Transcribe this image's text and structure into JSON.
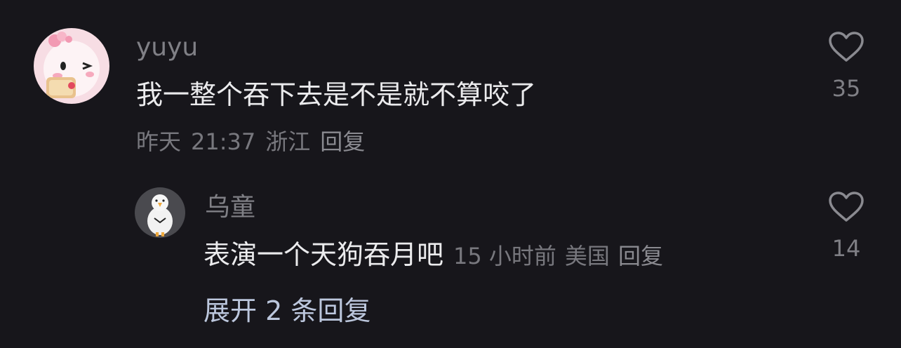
{
  "comment": {
    "username": "yuyu",
    "text": "我一整个吞下去是不是就不算咬了",
    "date": "昨天",
    "time": "21:37",
    "location": "浙江",
    "reply_label": "回复",
    "like_count": "35",
    "avatar_icon": "pink-cartoon-character-avatar"
  },
  "reply": {
    "username": "乌童",
    "text": "表演一个天狗吞月吧",
    "time": "15 小时前",
    "location": "美国",
    "reply_label": "回复",
    "like_count": "14",
    "avatar_icon": "white-duck-avatar"
  },
  "expand_replies": {
    "label": "展开 2 条回复"
  },
  "colors": {
    "background": "#17161b",
    "primary_text": "#ebebed",
    "secondary_text": "#808086",
    "link_text": "#bcc7dd"
  }
}
